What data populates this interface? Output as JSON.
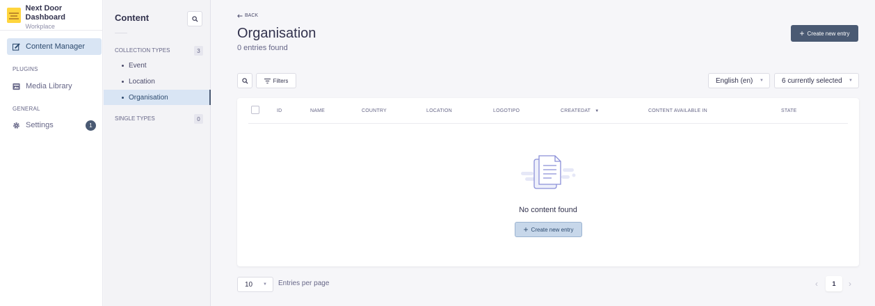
{
  "app": {
    "name": "Next Door Dashboard",
    "workspace": "Workplace"
  },
  "mainnav": {
    "content_manager": "Content Manager",
    "plugins_header": "PLUGINS",
    "media_library": "Media Library",
    "general_header": "GENERAL",
    "settings": "Settings",
    "settings_badge": "1"
  },
  "subnav": {
    "title": "Content",
    "collection_header": "COLLECTION TYPES",
    "collection_count": "3",
    "items": [
      "Event",
      "Location",
      "Organisation"
    ],
    "single_header": "SINGLE TYPES",
    "single_count": "0"
  },
  "main": {
    "back": "BACK",
    "title": "Organisation",
    "entries_found": "0 entries found",
    "create_button": "Create new entry",
    "filters": "Filters",
    "locale": "English (en)",
    "columns_selected": "6 currently selected",
    "columns": [
      "ID",
      "NAME",
      "COUNTRY",
      "LOCATION",
      "LOGOTIPO",
      "CREATEDAT",
      "CONTENT AVAILABLE IN",
      "STATE"
    ],
    "empty_text": "No content found",
    "empty_button": "Create new entry",
    "per_page_value": "10",
    "per_page_label": "Entries per page",
    "current_page": "1"
  },
  "colors": {
    "primary": "#4a5a73",
    "active_bg": "#d9e5f4",
    "brand_logo": "#ffd53d"
  }
}
